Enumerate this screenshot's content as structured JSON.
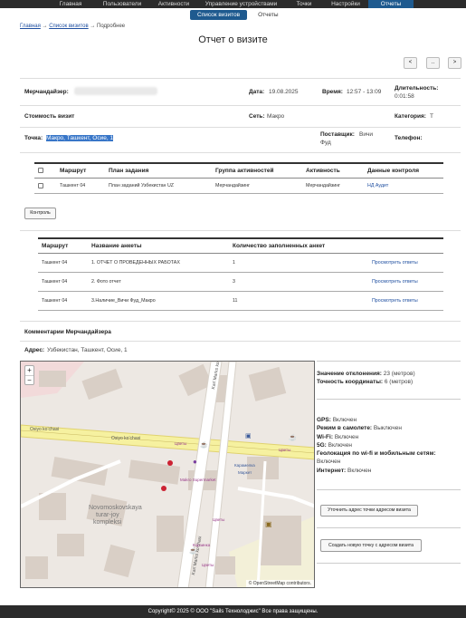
{
  "nav": {
    "items": [
      "Главная",
      "Пользователи",
      "Активности",
      "Управление устройствами",
      "Точки",
      "Настройки",
      "Отчеты"
    ],
    "active_index": 6
  },
  "subtabs": {
    "visits": "Список визитов",
    "reports": "Отчеты"
  },
  "breadcrumb": {
    "home": "Главная",
    "visits": "Список визитов",
    "current": "Подробнее",
    "sep": "→"
  },
  "page_title": "Отчет о визите",
  "pager": {
    "prev": "<",
    "mid": "..",
    "next": ">"
  },
  "info": {
    "merch_label": "Мерчандайзер:",
    "merch_value": "",
    "date_label": "Дата:",
    "date_value": "19.08.2025",
    "time_label": "Время:",
    "time_value": "12:57 - 13:09",
    "duration_label": "Длительность:",
    "duration_value": "0:01:58",
    "cost_label": "Стоимость визит",
    "cost_value": "",
    "network_label": "Сеть:",
    "network_value": "Макро",
    "category_label": "Категория:",
    "category_value": "Т",
    "point_label": "Точка:",
    "point_value": "Макро, Ташкент, Осие, 1",
    "supplier_label": "Поставщик:",
    "supplier_value": "Вичи Фуд",
    "phone_label": "Телефон:",
    "phone_value": ""
  },
  "plan_table": {
    "headers": [
      "Маршрут",
      "План задания",
      "Группа активностей",
      "Активность",
      "Данные контроля"
    ],
    "rows": [
      [
        "Ташкент 04",
        "План заданий Узбекистан UZ",
        "Мерчандайзинг",
        "Мерчандайзинг",
        "НД Аудит"
      ]
    ]
  },
  "control_button": "Контроль",
  "survey_table": {
    "headers": [
      "Маршрут",
      "Название анкеты",
      "Количество заполненных анкет",
      ""
    ],
    "rows": [
      [
        "Ташкент 04",
        "1. ОТЧЕТ О ПРОВЕДЕННЫХ РАБОТАХ",
        "1",
        "Просмотреть ответы"
      ],
      [
        "Ташкент 04",
        "2. Фото отчет",
        "3",
        "Просмотреть ответы"
      ],
      [
        "Ташкент 04",
        "3.Наличие_Вичи Фуд_Макро",
        "11",
        "Просмотреть ответы"
      ]
    ]
  },
  "comments_label": "Комментарии Мерчандайзера",
  "address_label": "Адрес:",
  "address_value": "Узбекистан, Ташкент, Осие, 1",
  "geo": {
    "deviation_label": "Значение отклонения:",
    "deviation_value": "23 (метров)",
    "accuracy_label": "Точность координаты:",
    "accuracy_value": "6 (метров)",
    "gps_label": "GPS:",
    "gps_value": "Включен",
    "airplane_label": "Режим в самолете:",
    "airplane_value": "Выключен",
    "wifi_label": "Wi-Fi:",
    "wifi_value": "Включен",
    "g5_label": "5G:",
    "g5_value": "Включен",
    "geoloc_label": "Геолокация по wi-fi и мобильным сетям:",
    "geoloc_value": "Включен",
    "internet_label": "Интернет:",
    "internet_value": "Включен",
    "refine_button": "Уточнить адрес точки адресом визита",
    "create_button": "Создать новую точку с адресом визита"
  },
  "map": {
    "zoom_in": "+",
    "zoom_out": "−",
    "attribution": "© OpenStreetMap contributors.",
    "street1": "Osiyo ko‘chasi",
    "street2": "Osiyo ko‘chasi",
    "street3": "Karl Marks ko‘chasi",
    "street4": "Karl Marks ko‘chasi",
    "district1": "Novomoskovskaya",
    "district2": "turar-joy",
    "district3": "kompleksi",
    "poi1": "Цветы",
    "poi2": "Цветы",
    "poi3": "Карамелка",
    "poi4": "Makro Supermarket",
    "poi5": "Цветы",
    "poi6": "Маркет",
    "poi7": "Корзинка",
    "poi8": "Цветы"
  },
  "footer": "Copyright© 2025 © ООО \"Sails Технолоджис\" Все права защищены."
}
